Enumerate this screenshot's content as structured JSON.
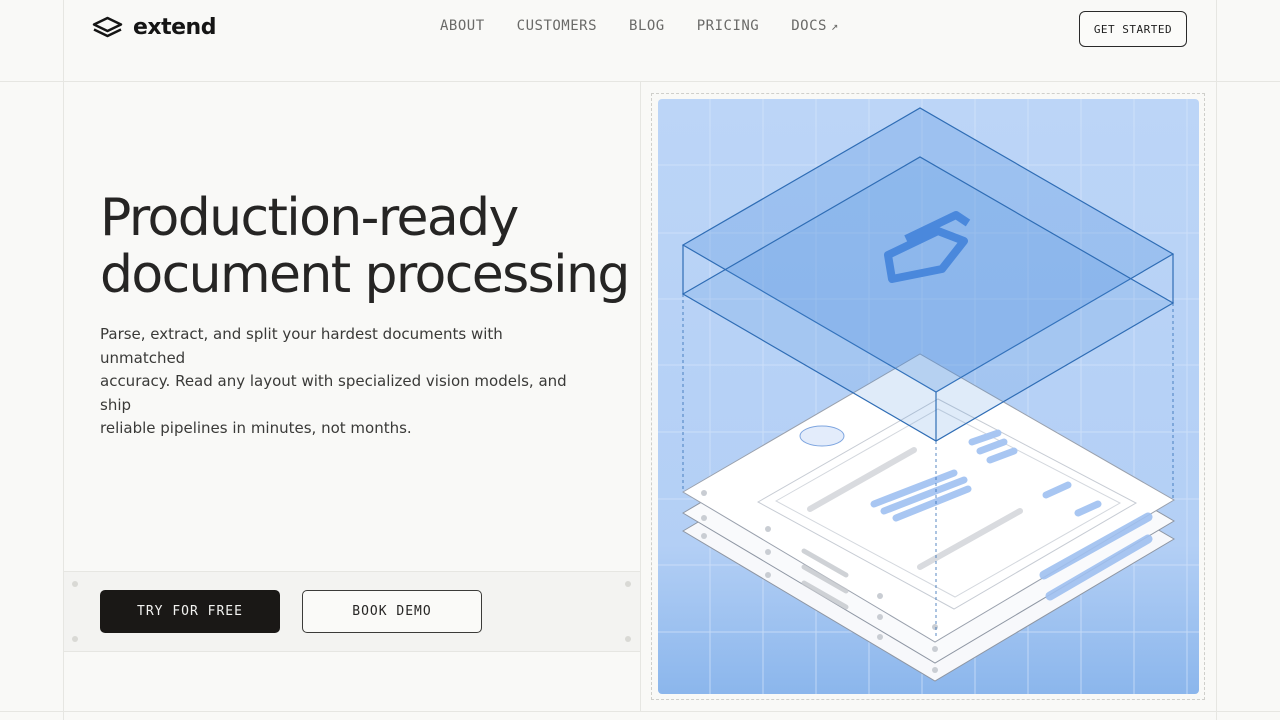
{
  "brand": {
    "name": "extend",
    "logo_icon": "layers-logo-icon"
  },
  "nav": {
    "items": [
      {
        "label": "ABOUT"
      },
      {
        "label": "CUSTOMERS"
      },
      {
        "label": "BLOG"
      },
      {
        "label": "PRICING"
      },
      {
        "label": "DOCS"
      }
    ],
    "docs_icon": "external-arrow-icon"
  },
  "header": {
    "cta_label": "GET STARTED"
  },
  "hero": {
    "title_lines": [
      "Production-ready",
      "document processing"
    ],
    "subtitle_lines": [
      "Parse, extract, and split your hardest documents with unmatched",
      "accuracy. Read any layout with specialized vision models, and ship",
      "reliable pipelines in minutes, not months."
    ],
    "primary_cta": "TRY FOR FREE",
    "secondary_cta": "BOOK DEMO"
  },
  "illustration": {
    "name": "document-stack-illustration",
    "accent_color": "#4f8fe0",
    "bg_color": "#b8d2f6",
    "line_color": "#2f6db5"
  }
}
